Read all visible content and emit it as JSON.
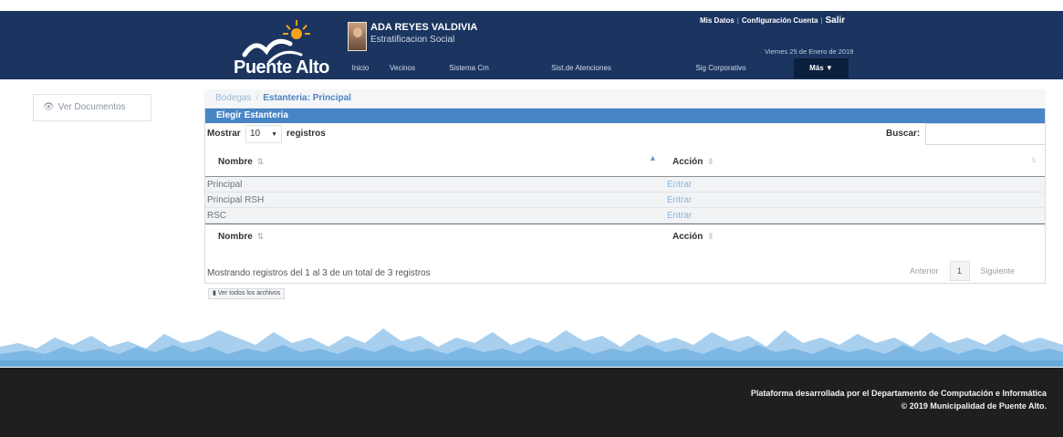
{
  "header": {
    "logo_text": "Puente Alto",
    "user_name": "ADA REYES VALDIVIA",
    "user_role": "Estratificacion Social",
    "top_links": [
      "Mis Datos",
      "Configuración Cuenta",
      "Salir"
    ],
    "date": "Viernes 25 de Enero de 2019",
    "nav": [
      "Inicio",
      "Vecinos",
      "Sistema Cm",
      "Sist.de Atenciones",
      "Sig Corporativo",
      "Más ▼"
    ]
  },
  "sidebar": {
    "ver_documentos": "Ver Documentos"
  },
  "breadcrumb": {
    "home": "Bodegas",
    "sep": "/",
    "current": "Estanteria: Principal"
  },
  "panel": {
    "title": "Elegir Estanteria",
    "mostrar": "Mostrar",
    "length_value": "10",
    "registros": "registros",
    "buscar": "Buscar:",
    "columns": {
      "nombre": "Nombre",
      "accion": "Acción"
    },
    "rows": [
      {
        "nombre": "Principal",
        "accion": "Entrar"
      },
      {
        "nombre": "Principal RSH",
        "accion": "Entrar"
      },
      {
        "nombre": "RSC",
        "accion": "Entrar"
      }
    ],
    "info": "Mostrando registros del 1 al 3 de un total de 3 registros",
    "pager": {
      "prev": "Anterior",
      "page": "1",
      "next": "Siguiente"
    }
  },
  "ver_todos": "Ver todos los archivos",
  "footer": {
    "line1": "Plataforma desarrollada por el Departamento de Computación e Informática",
    "line2": "© 2019 Municipalidad de Puente Alto."
  },
  "colors": {
    "header": "#1b3560",
    "panel_header": "#4785c5",
    "link": "#4c83c1",
    "footer": "#1f1f1f"
  }
}
